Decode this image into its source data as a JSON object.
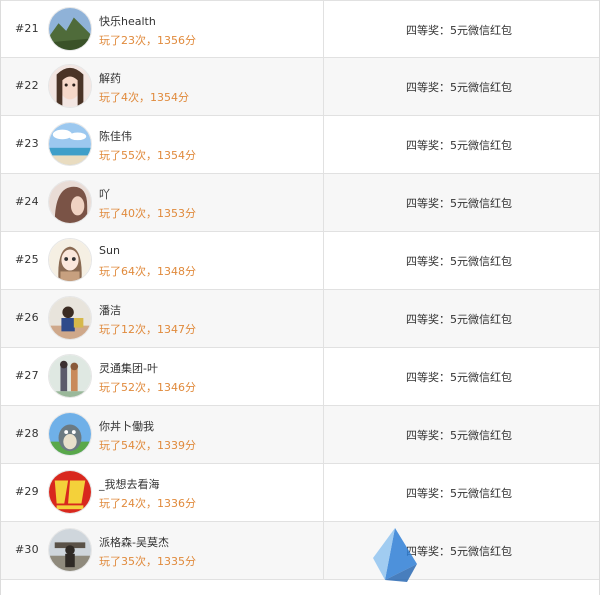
{
  "rows": [
    {
      "rank": "#21",
      "name": "快乐health",
      "played": "玩了23次，1356分",
      "prize": "四等奖：5元微信红包"
    },
    {
      "rank": "#22",
      "name": "解药",
      "played": "玩了4次，1354分",
      "prize": "四等奖：5元微信红包"
    },
    {
      "rank": "#23",
      "name": "陈佳伟",
      "played": "玩了55次，1354分",
      "prize": "四等奖：5元微信红包"
    },
    {
      "rank": "#24",
      "name": "吖",
      "played": "玩了40次，1353分",
      "prize": "四等奖：5元微信红包"
    },
    {
      "rank": "#25",
      "name": "Sun",
      "played": "玩了64次，1348分",
      "prize": "四等奖：5元微信红包"
    },
    {
      "rank": "#26",
      "name": "潘洁",
      "played": "玩了12次，1347分",
      "prize": "四等奖：5元微信红包"
    },
    {
      "rank": "#27",
      "name": "灵通集团-叶",
      "played": "玩了52次，1346分",
      "prize": "四等奖：5元微信红包"
    },
    {
      "rank": "#28",
      "name": "你丼卜働我",
      "played": "玩了54次，1339分",
      "prize": "四等奖：5元微信红包"
    },
    {
      "rank": "#29",
      "name": "_我想去看海",
      "played": "玩了24次，1336分",
      "prize": "四等奖：5元微信红包"
    },
    {
      "rank": "#30",
      "name": "派格森-吴莫杰",
      "played": "玩了35次，1335分",
      "prize": "四等奖：5元微信红包"
    }
  ],
  "colors": {
    "played_text": "#e08a3c",
    "row_alt_bg": "#f7f7f7",
    "border": "#e1e1e1"
  }
}
